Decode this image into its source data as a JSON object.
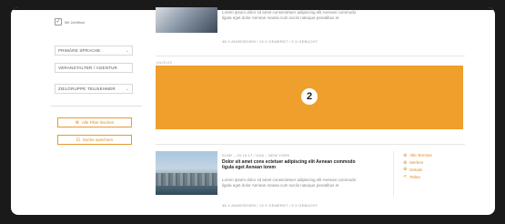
{
  "sidebar": {
    "checkbox_label": "Mit Zertifikat",
    "checkbox_mark": "✓",
    "selects": [
      {
        "label": "PRIMÄRE SPRACHE"
      },
      {
        "label": "VERANSTALTER / AGENTUR"
      },
      {
        "label": "ZIELGRUPPE TEILNEHMER"
      }
    ],
    "buttons": [
      {
        "label": "Alle Filter löschen",
        "icon": "⊗"
      },
      {
        "label": "Suche speichern",
        "icon": "⊡"
      }
    ]
  },
  "event1": {
    "description": "Lorem ipsum dolor sit amet consectetuer adipiscing elit Aenean commodo ligula eget dolor Aenean massa cum sociis natoque penatibus et",
    "meta": "48 X ANGESEHEN  /  13 X GEMERKT  /  9 X GEBUCHT"
  },
  "ad": {
    "label": "ANZEIGE",
    "badge": "2",
    "color": "#ef9f2c"
  },
  "event2": {
    "meta_top": "ELNE  –  20.10.17  /  USA  –  NEW YORK",
    "heading": "Dolor sit amet cons ectetuer adipiscing elit Aenean commodo ligula eget Aenean lorem",
    "description": "Lorem ipsum dolor sit amet consectetuer adipiscing elit Aenean commodo ligula eget dolor Aenean massa cum sociis natoque penatibus et",
    "meta": "48 X ANGESEHEN  /  13 X GEMERKT  /  9 X GEBUCHT",
    "actions": [
      {
        "label": "Alle Termine",
        "icon": "⊕"
      },
      {
        "label": "Merken",
        "icon": "⊕"
      },
      {
        "label": "Details",
        "icon": "⊕"
      },
      {
        "label": "Teilen",
        "icon": "<"
      }
    ]
  },
  "colors": {
    "accent": "#e08a1f",
    "frame": "#1a1a1a"
  }
}
